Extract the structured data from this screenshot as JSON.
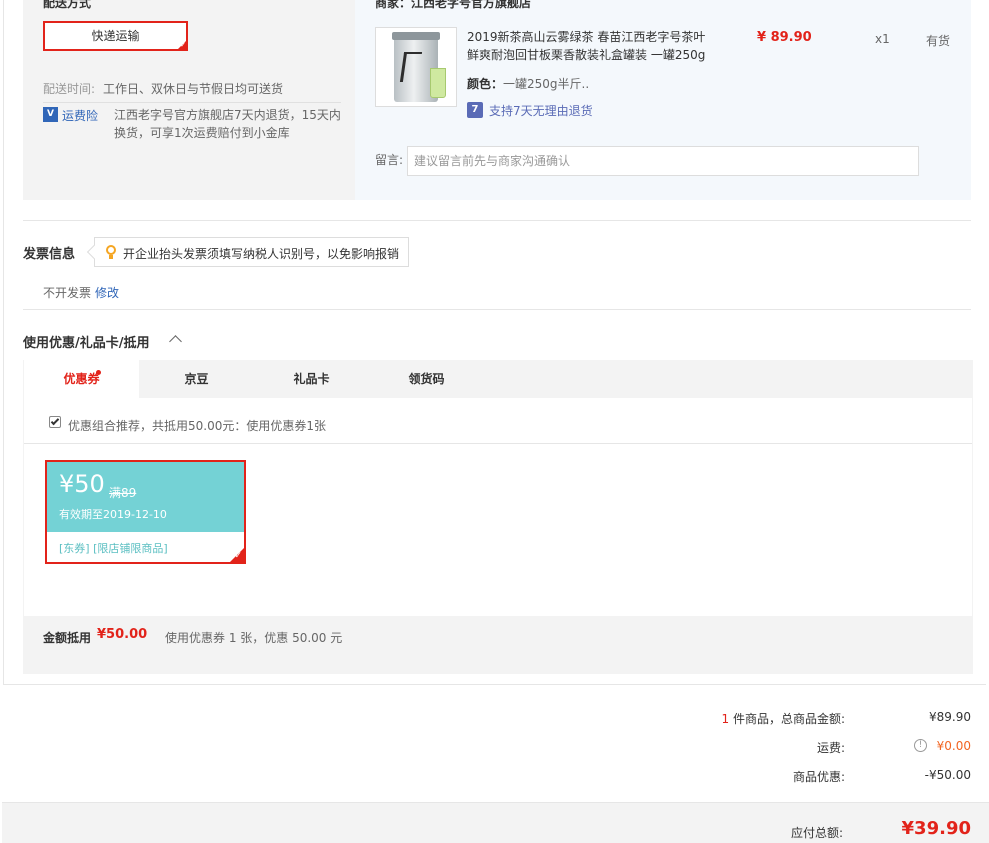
{
  "shipping": {
    "title": "配送方式",
    "method": "快递运输",
    "time_label": "配送时间:",
    "time_value": "工作日、双休日与节假日均可送货",
    "insurance_icon": "V",
    "insurance_label": "运费险",
    "insurance_text": "江西老字号官方旗舰店7天内退货，15天内换货，可享1次运费赔付到小金库"
  },
  "merchant": {
    "label": "商家：江西老字号官方旗舰店",
    "product": {
      "title": "2019新茶高山云雾绿茶 春苗江西老字号茶叶鲜爽耐泡回甘板栗香散装礼盒罐装 一罐250g",
      "color_label": "颜色：",
      "color_value": "一罐250g半斤..",
      "return_icon": "7",
      "return_text": "支持7天无理由退货",
      "price": "¥ 89.90",
      "qty": "x1",
      "stock": "有货"
    },
    "note_label": "留言:",
    "note_placeholder": "建议留言前先与商家沟通确认"
  },
  "invoice": {
    "title": "发票信息",
    "tip": "开企业抬头发票须填写纳税人识别号，以免影响报销",
    "value": "不开发票",
    "edit": "修改"
  },
  "coupons": {
    "title": "使用优惠/礼品卡/抵用",
    "tabs": [
      {
        "label": "优惠券"
      },
      {
        "label": "京豆"
      },
      {
        "label": "礼品卡"
      },
      {
        "label": "领货码"
      }
    ],
    "combo_text": "优惠组合推荐，共抵用50.00元：使用优惠券1张",
    "coupon": {
      "amount": "¥50",
      "condition": "满89",
      "expiry": "有效期至2019-12-10",
      "tags": "[东券]  [限店铺限商品]"
    },
    "summary_label": "金额抵用",
    "summary_value": "¥50.00",
    "summary_desc": "使用优惠券 1 张，优惠 50.00 元"
  },
  "totals": {
    "count": "1",
    "goods_label": " 件商品，总商品金额:",
    "goods_value": "¥89.90",
    "freight_label": "运费:",
    "freight_value": "¥0.00",
    "discount_label": "商品优惠:",
    "discount_value": "-¥50.00",
    "pay_label": "应付总额:",
    "pay_value": "¥39.90"
  },
  "colors": {
    "accent": "#e2231a",
    "link": "#3066b8",
    "coupon": "#74d2d5"
  }
}
